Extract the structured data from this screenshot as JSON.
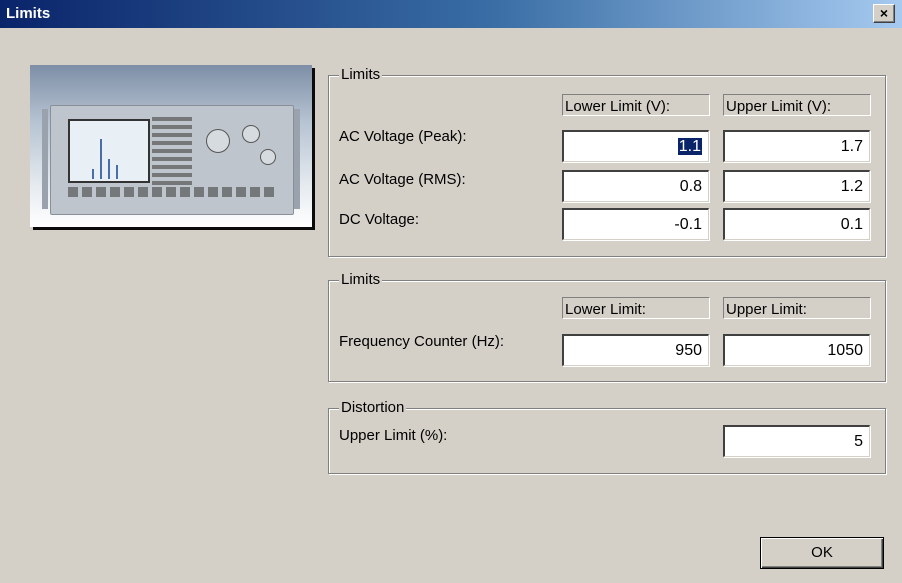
{
  "window": {
    "title": "Limits",
    "close_glyph": "×"
  },
  "image": {
    "name": "signal-analyzer-device-photo"
  },
  "voltage_group": {
    "legend": "Limits",
    "lower_header": "Lower Limit (V):",
    "upper_header": "Upper Limit (V):",
    "rows": [
      {
        "label": "AC Voltage (Peak):",
        "lower": "1.1",
        "upper": "1.7"
      },
      {
        "label": "AC Voltage (RMS):",
        "lower": "0.8",
        "upper": "1.2"
      },
      {
        "label": "DC Voltage:",
        "lower": "-0.1",
        "upper": "0.1"
      }
    ]
  },
  "frequency_group": {
    "legend": "Limits",
    "lower_header": "Lower Limit:",
    "upper_header": "Upper Limit:",
    "label": "Frequency Counter (Hz):",
    "lower": "950",
    "upper": "1050"
  },
  "distortion_group": {
    "legend": "Distortion",
    "label": "Upper Limit (%):",
    "upper": "5"
  },
  "buttons": {
    "ok": "OK"
  },
  "colors": {
    "titlebar_start": "#0a246a",
    "titlebar_end": "#a6caf0",
    "dialog_bg": "#d4d0c8",
    "selection": "#0a246a"
  }
}
